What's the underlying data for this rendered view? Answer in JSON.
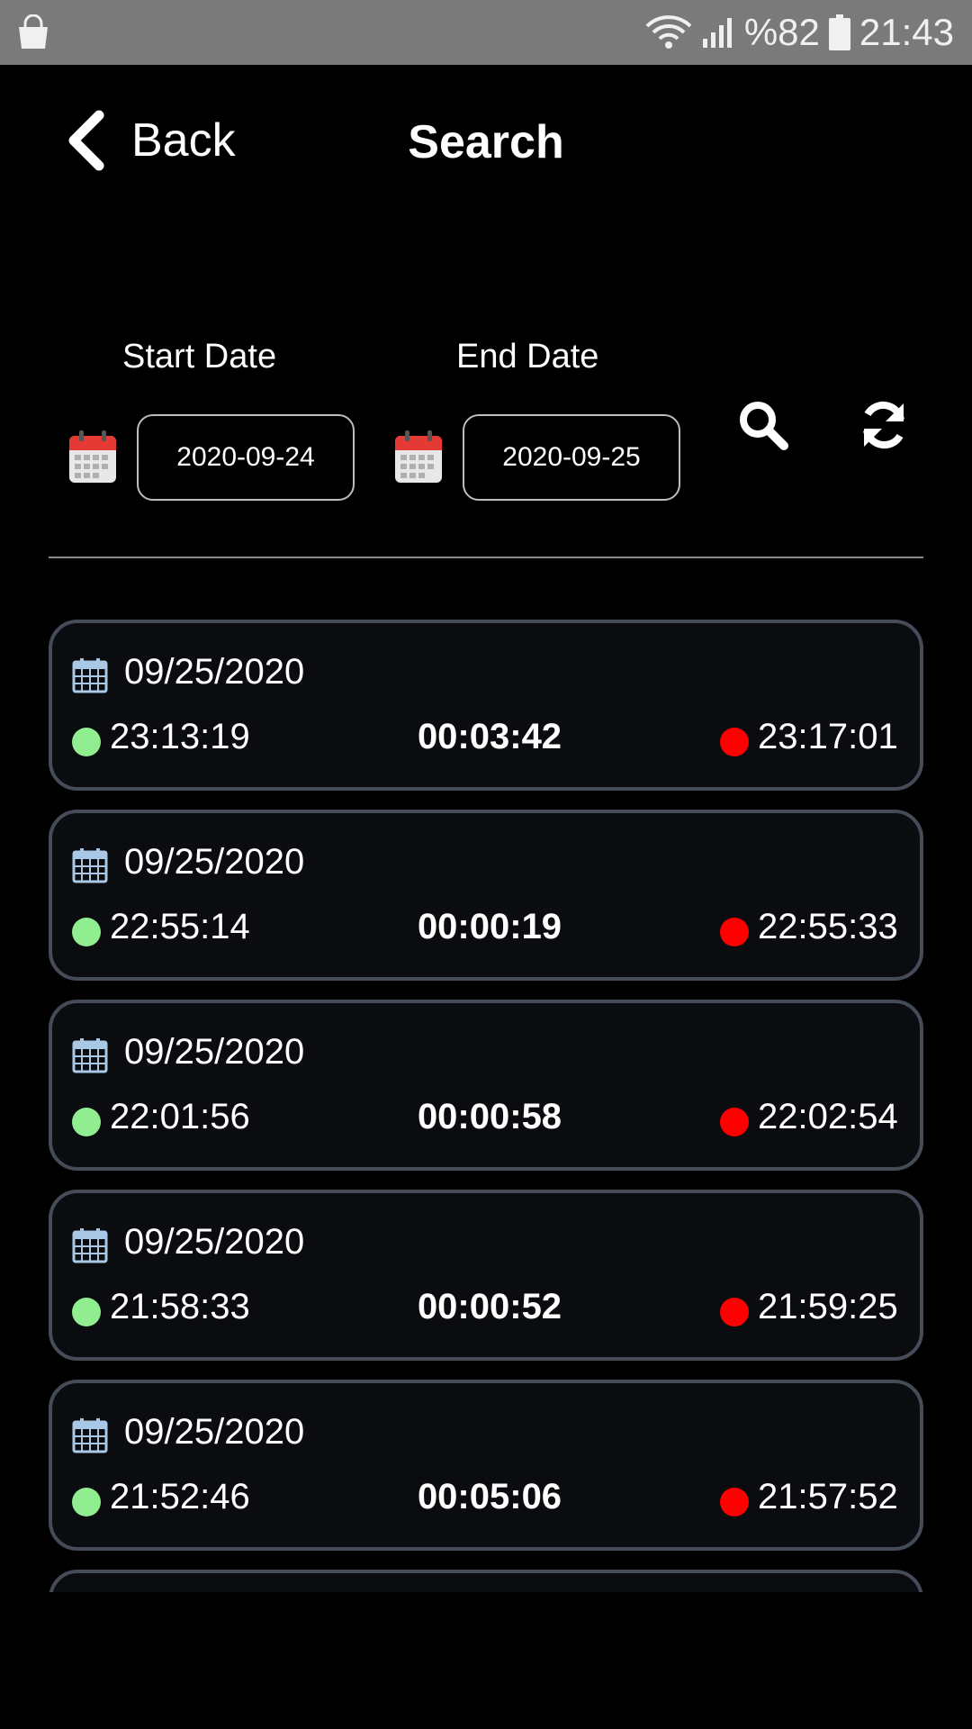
{
  "status_bar": {
    "battery": "%82",
    "time": "21:43"
  },
  "header": {
    "back_label": "Back",
    "title": "Search"
  },
  "filters": {
    "start_label": "Start Date",
    "start_value": "2020-09-24",
    "end_label": "End Date",
    "end_value": "2020-09-25"
  },
  "records": [
    {
      "date": "09/25/2020",
      "start": "23:13:19",
      "duration": "00:03:42",
      "end": "23:17:01"
    },
    {
      "date": "09/25/2020",
      "start": "22:55:14",
      "duration": "00:00:19",
      "end": "22:55:33"
    },
    {
      "date": "09/25/2020",
      "start": "22:01:56",
      "duration": "00:00:58",
      "end": "22:02:54"
    },
    {
      "date": "09/25/2020",
      "start": "21:58:33",
      "duration": "00:00:52",
      "end": "21:59:25"
    },
    {
      "date": "09/25/2020",
      "start": "21:52:46",
      "duration": "00:05:06",
      "end": "21:57:52"
    }
  ],
  "colors": {
    "start_dot": "#90ee90",
    "end_dot": "#ff0000",
    "card_border": "#454c58"
  }
}
